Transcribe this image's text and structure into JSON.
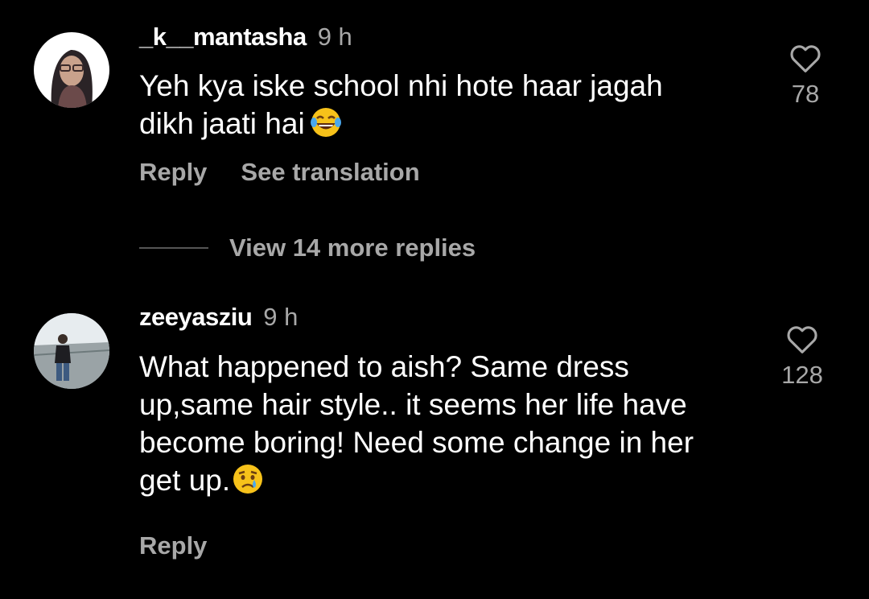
{
  "comments": [
    {
      "username": "_k__mantasha",
      "time": "9 h",
      "text_lines": [
        "Yeh kya iske school nhi hote haar jagah",
        "dikh jaati hai"
      ],
      "emoji": "tears-of-joy-emoji",
      "like_count": "78",
      "reply_label": "Reply",
      "translation_label": "See translation"
    },
    {
      "username": "zeeyasziu",
      "time": "9 h",
      "text_lines": [
        "What happened to aish? Same dress",
        "up,same hair style.. it seems her life have",
        "become boring! Need some change in her",
        "get up."
      ],
      "emoji": "crying-face-emoji",
      "like_count": "128",
      "reply_label": "Reply"
    }
  ],
  "view_more_replies": "View 14 more replies",
  "icons": {
    "like": "heart-outline-icon"
  },
  "colors": {
    "background": "#000000",
    "primary_text": "#ffffff",
    "secondary_text": "#a8a8a8"
  }
}
